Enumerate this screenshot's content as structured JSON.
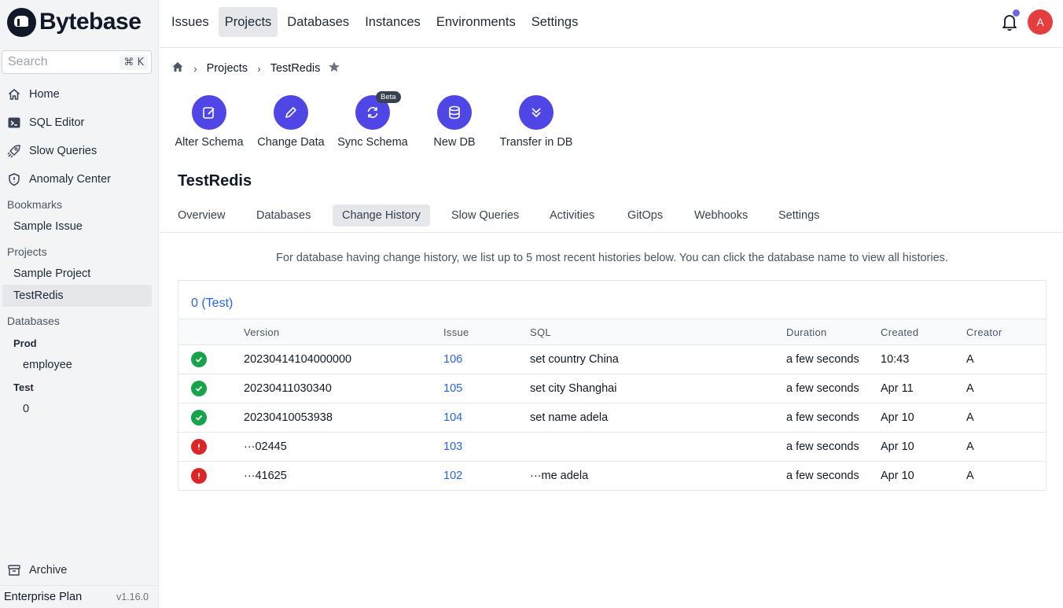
{
  "app": {
    "name": "Bytebase"
  },
  "search": {
    "placeholder": "Search",
    "shortcut": "⌘ K"
  },
  "sidebar": {
    "items": [
      {
        "label": "Home",
        "icon": "home-icon"
      },
      {
        "label": "SQL Editor",
        "icon": "terminal-icon"
      },
      {
        "label": "Slow Queries",
        "icon": "rocket-icon"
      },
      {
        "label": "Anomaly Center",
        "icon": "shield-icon"
      }
    ],
    "bookmarks_title": "Bookmarks",
    "bookmarks": [
      "Sample Issue"
    ],
    "projects_title": "Projects",
    "projects": [
      "Sample Project",
      "TestRedis"
    ],
    "databases_title": "Databases",
    "environments": [
      {
        "name": "Prod",
        "databases": [
          "employee"
        ]
      },
      {
        "name": "Test",
        "databases": [
          "0"
        ]
      }
    ],
    "archive_label": "Archive",
    "plan": "Enterprise Plan",
    "version": "v1.16.0"
  },
  "topnav": {
    "items": [
      "Issues",
      "Projects",
      "Databases",
      "Instances",
      "Environments",
      "Settings"
    ],
    "active": "Projects",
    "avatar_initial": "A"
  },
  "breadcrumb": {
    "items": [
      "Projects",
      "TestRedis"
    ]
  },
  "quick_actions": [
    {
      "label": "Alter Schema",
      "icon": "edit-icon"
    },
    {
      "label": "Change Data",
      "icon": "pencil-icon"
    },
    {
      "label": "Sync Schema",
      "icon": "sync-icon",
      "badge": "Beta"
    },
    {
      "label": "New DB",
      "icon": "database-icon"
    },
    {
      "label": "Transfer in DB",
      "icon": "chevrons-down-icon"
    }
  ],
  "project": {
    "title": "TestRedis"
  },
  "tabs": [
    "Overview",
    "Databases",
    "Change History",
    "Slow Queries",
    "Activities",
    "GitOps",
    "Webhooks",
    "Settings"
  ],
  "active_tab": "Change History",
  "info_text": "For database having change history, we list up to 5 most recent histories below. You can click the database name to view all histories.",
  "history": {
    "title": "0 (Test)",
    "columns": [
      "Version",
      "Issue",
      "SQL",
      "Duration",
      "Created",
      "Creator"
    ],
    "rows": [
      {
        "status": "done",
        "version": "20230414104000000",
        "issue": "106",
        "sql": "set country China",
        "duration": "a few seconds",
        "created": "10:43",
        "creator": "A"
      },
      {
        "status": "done",
        "version": "20230411030340",
        "issue": "105",
        "sql": "set city Shanghai",
        "duration": "a few seconds",
        "created": "Apr 11",
        "creator": "A"
      },
      {
        "status": "done",
        "version": "20230410053938",
        "issue": "104",
        "sql": "set name adela",
        "duration": "a few seconds",
        "created": "Apr 10",
        "creator": "A"
      },
      {
        "status": "failed",
        "version": "···02445",
        "issue": "103",
        "sql": "",
        "duration": "a few seconds",
        "created": "Apr 10",
        "creator": "A"
      },
      {
        "status": "failed",
        "version": "···41625",
        "issue": "102",
        "sql": "···me adela",
        "duration": "a few seconds",
        "created": "Apr 10",
        "creator": "A"
      }
    ]
  },
  "colors": {
    "accent": "#4f46e5",
    "link": "#2563eb",
    "success": "#16a34a",
    "error": "#dc2626",
    "avatar": "#e53e3e"
  }
}
